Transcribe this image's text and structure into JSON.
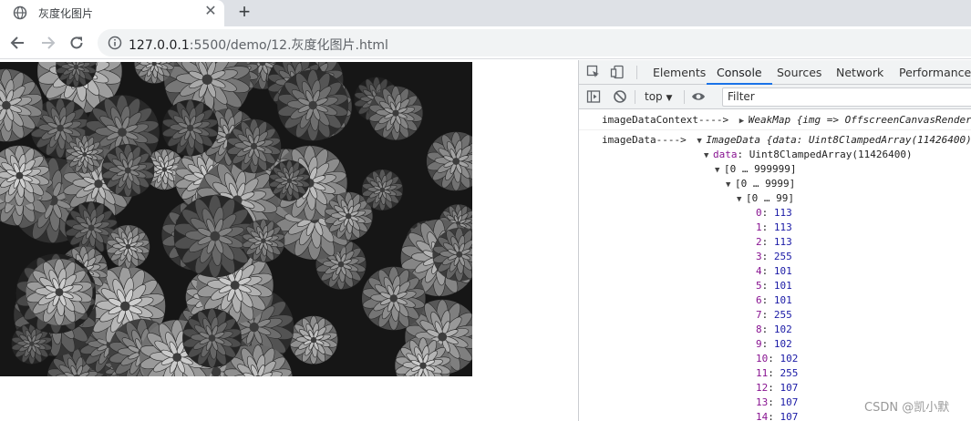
{
  "browser": {
    "tab_title": "灰度化图片",
    "close_symbol": "✕",
    "newtab_symbol": "+",
    "url_host": "127.0.0.1",
    "url_path": ":5500/demo/12.灰度化图片.html"
  },
  "devtools": {
    "tabs": [
      "Elements",
      "Console",
      "Sources",
      "Network",
      "Performance"
    ],
    "active_tab": "Console",
    "context": "top",
    "filter_placeholder": "Filter"
  },
  "console": {
    "msg1": {
      "label": "imageDataContext---->",
      "type": "WeakMap",
      "preview": "{img => OffscreenCanvasRenderi"
    },
    "msg2": {
      "label": "imageData---->",
      "type": "ImageData",
      "preview": "{data: Uint8ClampedArray(11426400),",
      "data_key": "data",
      "data_type": "Uint8ClampedArray(11426400)",
      "range1": "[0 … 999999]",
      "range2": "[0 … 9999]",
      "range3": "[0 … 99]",
      "entries": [
        {
          "k": "0",
          "v": "113"
        },
        {
          "k": "1",
          "v": "113"
        },
        {
          "k": "2",
          "v": "113"
        },
        {
          "k": "3",
          "v": "255"
        },
        {
          "k": "4",
          "v": "101"
        },
        {
          "k": "5",
          "v": "101"
        },
        {
          "k": "6",
          "v": "101"
        },
        {
          "k": "7",
          "v": "255"
        },
        {
          "k": "8",
          "v": "102"
        },
        {
          "k": "9",
          "v": "102"
        },
        {
          "k": "10",
          "v": "102"
        },
        {
          "k": "11",
          "v": "255"
        },
        {
          "k": "12",
          "v": "107"
        },
        {
          "k": "13",
          "v": "107"
        },
        {
          "k": "14",
          "v": "107"
        }
      ]
    }
  },
  "watermark": "CSDN @凯小默"
}
